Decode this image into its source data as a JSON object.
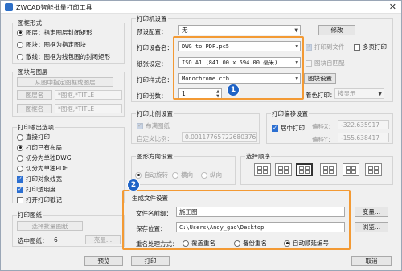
{
  "window": {
    "title": "ZWCAD智能批量打印工具",
    "close_glyph": "✕"
  },
  "frame": {
    "section_title": "图框形式",
    "options": [
      "图层：指定图层封闭矩形",
      "图块：图框为指定图块",
      "散线：图框为线包围的封闭矩形"
    ],
    "selected_index": 0
  },
  "layer_block": {
    "section_title": "图块与图层",
    "pick_button": "从图中指定图框或图层",
    "layer_name_button": "图层名",
    "layer_name_value": "*图框,*TITLE",
    "block_name_button": "图框名",
    "block_name_value": "*图框,*TITLE"
  },
  "output": {
    "section_title": "打印输出选项",
    "options": [
      "直接打印",
      "打印已有布局",
      "切分为单独DWG",
      "切分为单独PDF"
    ],
    "selected_index": 1,
    "checks": [
      {
        "label": "打印对象线宽",
        "checked": true
      },
      {
        "label": "打印透明度",
        "checked": true
      },
      {
        "label": "打开打印戳记",
        "checked": false
      }
    ]
  },
  "sheets": {
    "section_title": "打印图纸",
    "select_button": "选择批量图纸",
    "selected_label": "选中图纸：",
    "selected_count": "6",
    "highlight_button": "亮显..."
  },
  "printer": {
    "section_title": "打印机设置",
    "preset_label": "预设配置：",
    "preset_value": "无",
    "modify_button": "修改",
    "device_label": "打印设备名：",
    "device_value": "DWG to PDF.pc5",
    "print_to_file": "打印到文件",
    "multipage_pdf": "多页打印",
    "paper_label": "纸张设定：",
    "paper_value": "ISO A1 (841.00 x 594.00 毫米)",
    "block_auto_match": "图块自匹配",
    "style_label": "打印样式名：",
    "style_value": "Monochrome.ctb",
    "edit_style_button": "图块设置",
    "copies_label": "打印份数：",
    "copies_value": "1",
    "color_label": "着色打印：",
    "color_value": "按显示"
  },
  "scale": {
    "section_title": "打印比例设置",
    "fit_label": "布满图纸",
    "fit_checked": true,
    "custom_label": "自定义比例：",
    "custom_value": "0.00117765722680376"
  },
  "offset": {
    "section_title": "打印偏移设置",
    "center_label": "居中打印",
    "center_checked": true,
    "x_label": "偏移X：",
    "x_value": "-322.635917",
    "y_label": "偏移Y：",
    "y_value": "-155.638417"
  },
  "direction": {
    "section_title": "图形方向设置",
    "options": [
      "自动旋转",
      "横向",
      "纵向"
    ],
    "selected_index": 0
  },
  "order": {
    "section_title": "选择顺序",
    "icons": [
      "order-row-lr-icon",
      "order-col-tb-icon",
      "order-col-bt-icon",
      "order-row-rl-icon",
      "order-col-tb2-icon",
      "order-col-bt2-icon"
    ],
    "selected_index": 2
  },
  "generate": {
    "section_title": "生成文件设置",
    "prefix_label": "文件名前缀：",
    "prefix_value": "施工图",
    "variables_button": "变量...",
    "path_label": "保存位置：",
    "path_value": "C:\\Users\\Andy_gao\\Desktop",
    "browse_button": "浏览...",
    "rename_label": "重名处理方式：",
    "rename_options": [
      "覆盖重名",
      "备份重名",
      "自动顺延编号"
    ],
    "rename_selected": 2
  },
  "footer": {
    "preview": "预览",
    "print": "打印",
    "cancel": "取消"
  },
  "badges": {
    "one": "1",
    "two": "2"
  },
  "colors": {
    "highlight": "#f39a34",
    "badge": "#1f63c6"
  }
}
